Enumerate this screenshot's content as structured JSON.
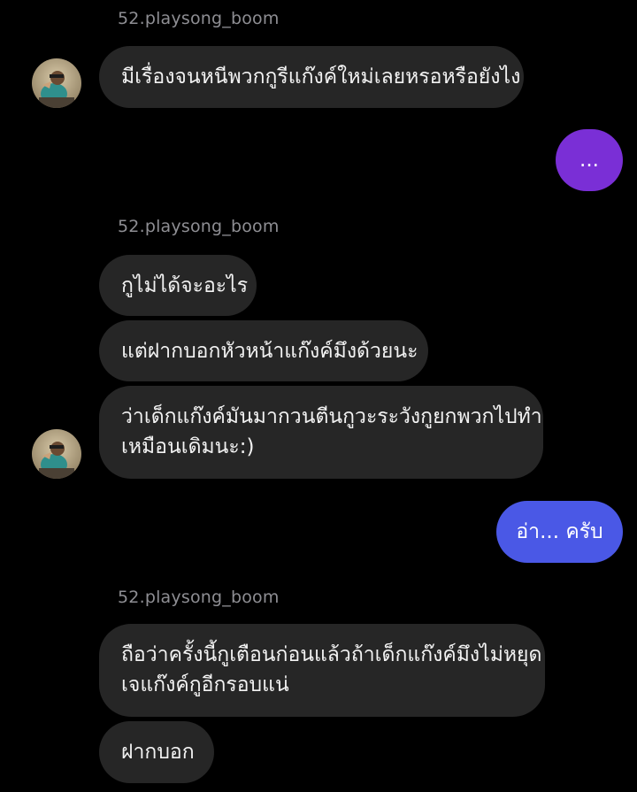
{
  "colors": {
    "background": "#000000",
    "incoming_bubble": "#262626",
    "outgoing_purple": "#7a2fd6",
    "outgoing_blue": "#4a58e6",
    "username_text": "#8e8e93"
  },
  "messages": [
    {
      "type": "sender",
      "text": "52.playsong_boom"
    },
    {
      "type": "incoming",
      "text": "มีเรื่องจนหนีพวกกูรีแก๊งค์ใหม่เลยหรอหรือยังไง"
    },
    {
      "type": "outgoing",
      "text": "..."
    },
    {
      "type": "sender",
      "text": "52.playsong_boom"
    },
    {
      "type": "incoming",
      "text": "กูไม่ได้จะอะไร"
    },
    {
      "type": "incoming",
      "text": "แต่ฝากบอกหัวหน้าแก๊งค์มึงด้วยนะ"
    },
    {
      "type": "incoming",
      "lines": [
        "ว่าเด็กแก๊งค์มันมากวนตีนกูวะระวังกูยกพวกไปทำ",
        "เหมือนเดิมนะ:)"
      ]
    },
    {
      "type": "outgoing",
      "text": "อ่า... ครับ"
    },
    {
      "type": "sender",
      "text": "52.playsong_boom"
    },
    {
      "type": "incoming",
      "lines": [
        "ถือว่าครั้งนี้กูเตือนก่อนแล้วถ้าเด็กแก๊งค์มึงไม่หยุด",
        "เจแก๊งค์กูอีกรอบแน่"
      ]
    },
    {
      "type": "incoming",
      "text": "ฝากบอก"
    }
  ]
}
